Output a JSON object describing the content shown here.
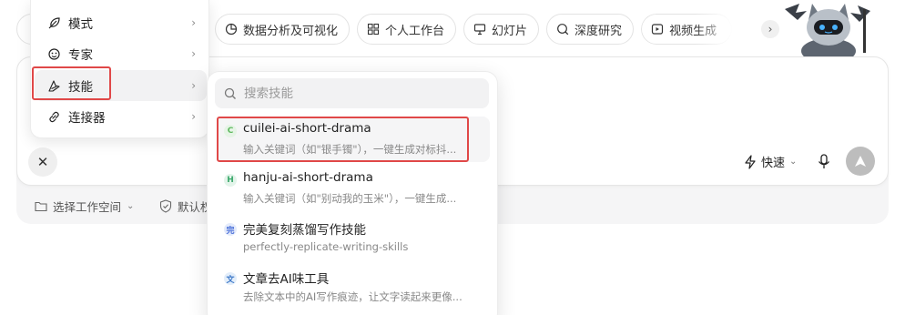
{
  "pills": [
    {
      "icon": "pie-chart-icon",
      "label": "数据分析及可视化"
    },
    {
      "icon": "grid-icon",
      "label": "个人工作台"
    },
    {
      "icon": "presentation-icon",
      "label": "幻灯片"
    },
    {
      "icon": "deep-research-icon",
      "label": "深度研究"
    },
    {
      "icon": "video-icon",
      "label": "视频生成"
    }
  ],
  "menu": {
    "items": [
      {
        "icon": "feather-icon",
        "label": "模式"
      },
      {
        "icon": "expert-icon",
        "label": "专家"
      },
      {
        "icon": "skill-icon",
        "label": "技能"
      },
      {
        "icon": "link-icon",
        "label": "连接器"
      }
    ]
  },
  "skills_panel": {
    "search_placeholder": "搜索技能",
    "items": [
      {
        "badge": "C",
        "badge_color": "#5fb85f",
        "badge_bg": "#e6f4e6",
        "name": "cuilei-ai-short-drama",
        "desc": "输入关键词（如\"银手镯\"），一键生成对标抖..."
      },
      {
        "badge": "H",
        "badge_color": "#3aa86b",
        "badge_bg": "#e3f4ea",
        "name": "hanju-ai-short-drama",
        "desc": "输入关键词（如\"别动我的玉米\"），一键生成..."
      },
      {
        "badge": "完",
        "badge_color": "#4a6fd8",
        "badge_bg": "#e4ebfb",
        "name": "完美复刻蒸馏写作技能",
        "desc": "perfectly-replicate-writing-skills"
      },
      {
        "badge": "文",
        "badge_color": "#3d78c8",
        "badge_bg": "#e3eefa",
        "name": "文章去AI味工具",
        "desc": "去除文本中的AI写作痕迹，让文字读起来更像..."
      }
    ]
  },
  "composer": {
    "close_icon": "close-icon",
    "speed_label": "快速",
    "workspace_label": "选择工作空间",
    "default_label": "默认权"
  },
  "colors": {
    "highlight": "#e04848",
    "send_button": "#bdbdbd"
  }
}
